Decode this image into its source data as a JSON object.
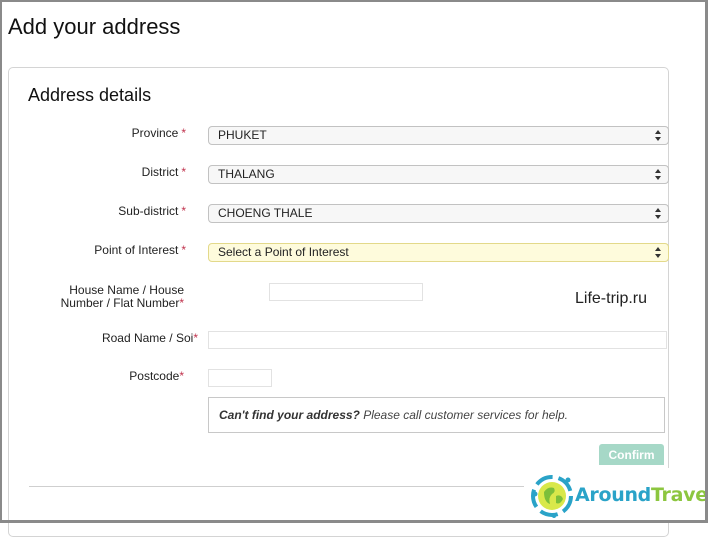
{
  "page": {
    "title": "Add your address"
  },
  "panel": {
    "title": "Address details"
  },
  "fields": {
    "province": {
      "label": "Province",
      "required": "*",
      "value": "PHUKET"
    },
    "district": {
      "label": "District",
      "required": "*",
      "value": "THALANG"
    },
    "subdistrict": {
      "label": "Sub-district",
      "required": "*",
      "value": "CHOENG THALE"
    },
    "poi": {
      "label": "Point of Interest",
      "required": "*",
      "value": "Select a Point of Interest"
    },
    "house": {
      "label_line1": "House Name / House",
      "label_line2": "Number / Flat Number",
      "required": "*",
      "value": ""
    },
    "road": {
      "label": "Road Name / Soi",
      "required": "*",
      "value": ""
    },
    "postcode": {
      "label": "Postcode",
      "required": "*",
      "value": ""
    }
  },
  "note": {
    "bold": "Can't find your address?",
    "text": " Please call customer services for help."
  },
  "actions": {
    "confirm_label": "Confirm"
  },
  "overlays": {
    "watermark": "Life-trip.ru",
    "logo_part1": "Around",
    "logo_part2": "Travels"
  },
  "colors": {
    "required": "#c0334d",
    "confirm_bg": "#a6d8c7",
    "highlight_bg": "#fefbdc",
    "logo_blue": "#2aa3c8",
    "logo_green": "#8cc63f"
  }
}
